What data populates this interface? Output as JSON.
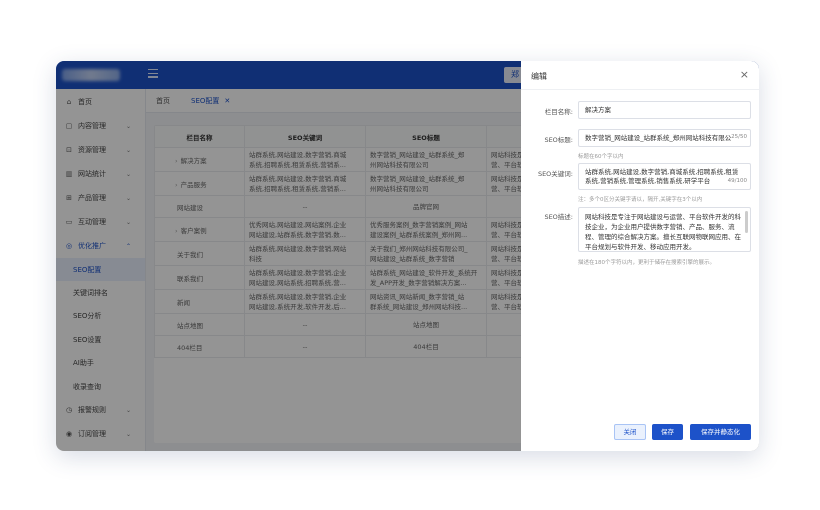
{
  "topbar": {
    "button_text": "郑"
  },
  "sidebar": {
    "items": [
      {
        "label": "首页",
        "icon": "home-icon",
        "glyph": "⌂",
        "arrow": ""
      },
      {
        "label": "内容管理",
        "icon": "document-icon",
        "glyph": "▢",
        "arrow": "⌄"
      },
      {
        "label": "资源管理",
        "icon": "folder-icon",
        "glyph": "⊡",
        "arrow": "⌄"
      },
      {
        "label": "网站统计",
        "icon": "chart-icon",
        "glyph": "▥",
        "arrow": "⌄"
      },
      {
        "label": "产品管理",
        "icon": "grid-icon",
        "glyph": "⊞",
        "arrow": "⌄"
      },
      {
        "label": "互动管理",
        "icon": "chat-icon",
        "glyph": "▭",
        "arrow": "⌄"
      },
      {
        "label": "优化推广",
        "icon": "megaphone-icon",
        "glyph": "◎",
        "arrow": "⌃"
      }
    ],
    "subitems": [
      "SEO配置",
      "关键词排名",
      "SEO分析",
      "SEO设置",
      "AI助手",
      "收录查询"
    ],
    "bottom_items": [
      {
        "label": "报警规则",
        "icon": "alert-icon",
        "glyph": "◷",
        "arrow": "⌄"
      },
      {
        "label": "订阅管理",
        "icon": "bell-icon",
        "glyph": "◉",
        "arrow": "⌄"
      }
    ]
  },
  "tabs": {
    "home": "首页",
    "seo": "SEO配置",
    "close": "✕"
  },
  "table": {
    "headers": [
      "栏目名称",
      "SEO关键词",
      "SEO标题",
      "SEO"
    ],
    "rows": [
      {
        "name": "解决方案",
        "tree": "›",
        "kw": [
          "站群系统,网站建设,数字营销,商城",
          "系统,招聘系统,租赁系统,营销系..."
        ],
        "title": [
          "数字营销_网站建设_站群系统_郑",
          "州网站科技有限公司"
        ],
        "desc": [
          "网站科技是专",
          "营、平台软件开"
        ]
      },
      {
        "name": "产品服务",
        "tree": "›",
        "kw": [
          "站群系统,网站建设,数字营销,商城",
          "系统,招聘系统,租赁系统,营销系..."
        ],
        "title": [
          "数字营销_网站建设_站群系统_郑",
          "州网站科技有限公司"
        ],
        "desc": [
          "网站科技是专",
          "营、平台软件开"
        ]
      },
      {
        "name": "网站建设",
        "tree": "",
        "kw": [
          "--"
        ],
        "title": [
          "品牌官网"
        ],
        "desc": [
          ""
        ]
      },
      {
        "name": "客户案例",
        "tree": "›",
        "kw": [
          "优秀网站,网站建设,网站案例,企业",
          "网站建设,站群系统,数字营销,数..."
        ],
        "title": [
          "优秀服务案例_数字营销案例_网站",
          "建设案例_站群系统案例_郑州网..."
        ],
        "desc": [
          "网站科技是专",
          "营、平台软件开"
        ]
      },
      {
        "name": "关于我们",
        "tree": "",
        "kw": [
          "站群系统,网站建设,数字营销,网站",
          "科技"
        ],
        "title": [
          "关于我们_郑州网站科技有限公司_",
          "网站建设_站群系统_数字营销"
        ],
        "desc": [
          "网站科技是专",
          "营、平台软件开"
        ]
      },
      {
        "name": "联系我们",
        "tree": "",
        "kw": [
          "站群系统,网站建设,数字营销,企业",
          "网站建设,网站系统,招聘系统,营..."
        ],
        "title": [
          "站群系统_网站建设_软件开发_系统开",
          "发_APP开发_数字营销解决方案..."
        ],
        "desc": [
          "网站科技是专",
          "营、平台软件开"
        ]
      },
      {
        "name": "新闻",
        "tree": "",
        "kw": [
          "站群系统,网站建设,数字营销,企业",
          "网站建设,系统开发,软件开发,后..."
        ],
        "title": [
          "网站资讯_网站新闻_数字营销_站",
          "群系统_网站建设_郑州网站科技..."
        ],
        "desc": [
          "网站科技是专",
          "营、平台软件开"
        ]
      },
      {
        "name": "站点地图",
        "tree": "",
        "kw": [
          "--"
        ],
        "title": [
          "站点地图"
        ],
        "desc": [
          ""
        ]
      },
      {
        "name": "404栏目",
        "tree": "",
        "kw": [
          "--"
        ],
        "title": [
          "404栏目"
        ],
        "desc": [
          ""
        ]
      }
    ]
  },
  "dialog": {
    "title": "编辑",
    "close": "×",
    "fields": {
      "name": {
        "label": "栏目名称:",
        "value": "解决方案"
      },
      "seo_title": {
        "label": "SEO标题:",
        "value": "数字营销_网站建设_站群系统_郑州网站科技有限公司",
        "counter": "25/50",
        "hint": "标题在60个字以内"
      },
      "seo_keywords": {
        "label": "SEO关键词:",
        "value": "站群系统,网站建设,数字营销,商城系统,招聘系统,租赁系统,营销系统,管理系统,销售系统,研学平台",
        "counter": "49/100",
        "hint": "注：多个0区分关键字请以，隔开,关键字在3个以内"
      },
      "seo_desc": {
        "label": "SEO描述:",
        "value": "网站科技是专注于网站建设与运营、平台软件开发的科技企业，为企业用户提供数字营销、产品、服务、流程、管理的综合解决方案。擅长互联网物联网应用、在平台规划与软件开发、移动应用开发。",
        "hint": "描述在180个字符以内，更利于储存在搜索引擎的展示。"
      }
    },
    "buttons": {
      "close": "关闭",
      "save": "保存",
      "save_static": "保存并静态化"
    }
  }
}
